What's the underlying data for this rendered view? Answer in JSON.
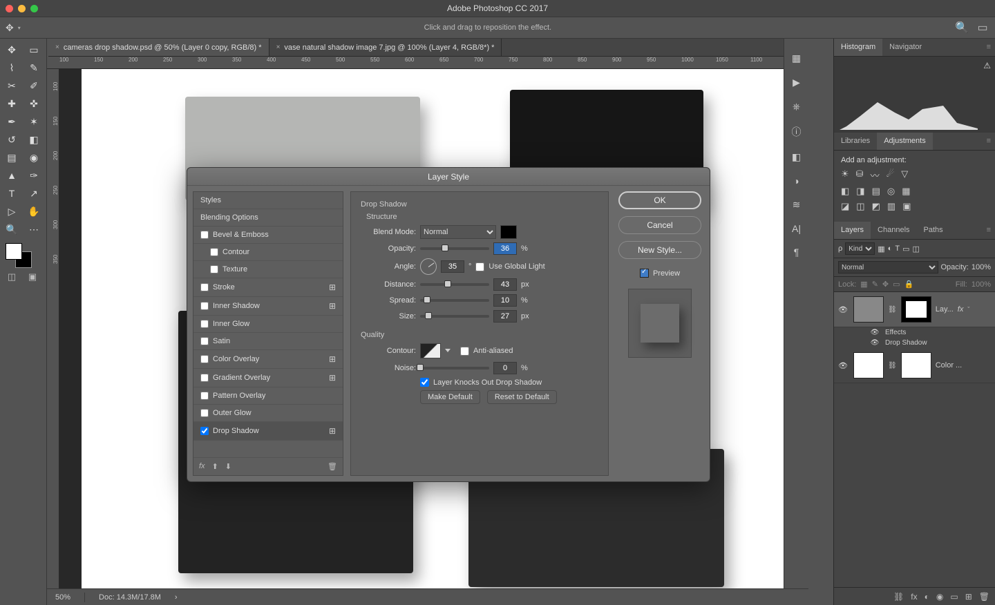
{
  "app": {
    "title": "Adobe Photoshop CC 2017"
  },
  "optionbar": {
    "hint": "Click and drag to reposition the effect."
  },
  "tabs": [
    {
      "label": "cameras drop shadow.psd @ 50% (Layer 0 copy, RGB/8) *",
      "active": true
    },
    {
      "label": "vase natural shadow image 7.jpg @ 100% (Layer 4, RGB/8*) *",
      "active": false
    }
  ],
  "status": {
    "zoom": "50%",
    "doc": "Doc: 14.3M/17.8M"
  },
  "ruler_h": [
    "100",
    "150",
    "200",
    "250",
    "300",
    "350",
    "400",
    "450",
    "500",
    "550",
    "600",
    "650",
    "700",
    "750",
    "800",
    "850",
    "900",
    "950",
    "1000",
    "1050",
    "1100"
  ],
  "ruler_v": [
    "100",
    "150",
    "200",
    "250",
    "300",
    "350"
  ],
  "right_panels": {
    "hist_tabs": [
      "Histogram",
      "Navigator"
    ],
    "lib_tabs": [
      "Libraries",
      "Adjustments"
    ],
    "adj_hint": "Add an adjustment:",
    "layers_tabs": [
      "Layers",
      "Channels",
      "Paths"
    ],
    "kind": "Kind",
    "mode": "Normal",
    "opacity_lbl": "Opacity:",
    "opacity_val": "100%",
    "lock_lbl": "Lock:",
    "fill_lbl": "Fill:",
    "fill_val": "100%",
    "layers": [
      {
        "name": "Lay...",
        "fx": "fx",
        "sub": [
          "Effects",
          "Drop Shadow"
        ]
      },
      {
        "name": "Color ..."
      }
    ]
  },
  "dialog": {
    "title": "Layer Style",
    "left": {
      "head": "Styles",
      "blend": "Blending Options",
      "items": [
        {
          "label": "Bevel & Emboss",
          "chk": false,
          "plus": false
        },
        {
          "label": "Contour",
          "chk": false,
          "indent": true
        },
        {
          "label": "Texture",
          "chk": false,
          "indent": true
        },
        {
          "label": "Stroke",
          "chk": false,
          "plus": true
        },
        {
          "label": "Inner Shadow",
          "chk": false,
          "plus": true
        },
        {
          "label": "Inner Glow",
          "chk": false
        },
        {
          "label": "Satin",
          "chk": false
        },
        {
          "label": "Color Overlay",
          "chk": false,
          "plus": true
        },
        {
          "label": "Gradient Overlay",
          "chk": false,
          "plus": true
        },
        {
          "label": "Pattern Overlay",
          "chk": false
        },
        {
          "label": "Outer Glow",
          "chk": false
        },
        {
          "label": "Drop Shadow",
          "chk": true,
          "plus": true,
          "sel": true
        }
      ]
    },
    "mid": {
      "section": "Drop Shadow",
      "structure": "Structure",
      "blend_mode_lbl": "Blend Mode:",
      "blend_mode_val": "Normal",
      "opacity_lbl": "Opacity:",
      "opacity_val": "36",
      "angle_lbl": "Angle:",
      "angle_val": "35",
      "angle_unit": "°",
      "global_light": "Use Global Light",
      "distance_lbl": "Distance:",
      "distance_val": "43",
      "px": "px",
      "spread_lbl": "Spread:",
      "spread_val": "10",
      "pct": "%",
      "size_lbl": "Size:",
      "size_val": "27",
      "quality": "Quality",
      "contour_lbl": "Contour:",
      "anti": "Anti-aliased",
      "noise_lbl": "Noise:",
      "noise_val": "0",
      "knockout": "Layer Knocks Out Drop Shadow",
      "make_default": "Make Default",
      "reset_default": "Reset to Default"
    },
    "right": {
      "ok": "OK",
      "cancel": "Cancel",
      "new_style": "New Style...",
      "preview": "Preview"
    }
  }
}
